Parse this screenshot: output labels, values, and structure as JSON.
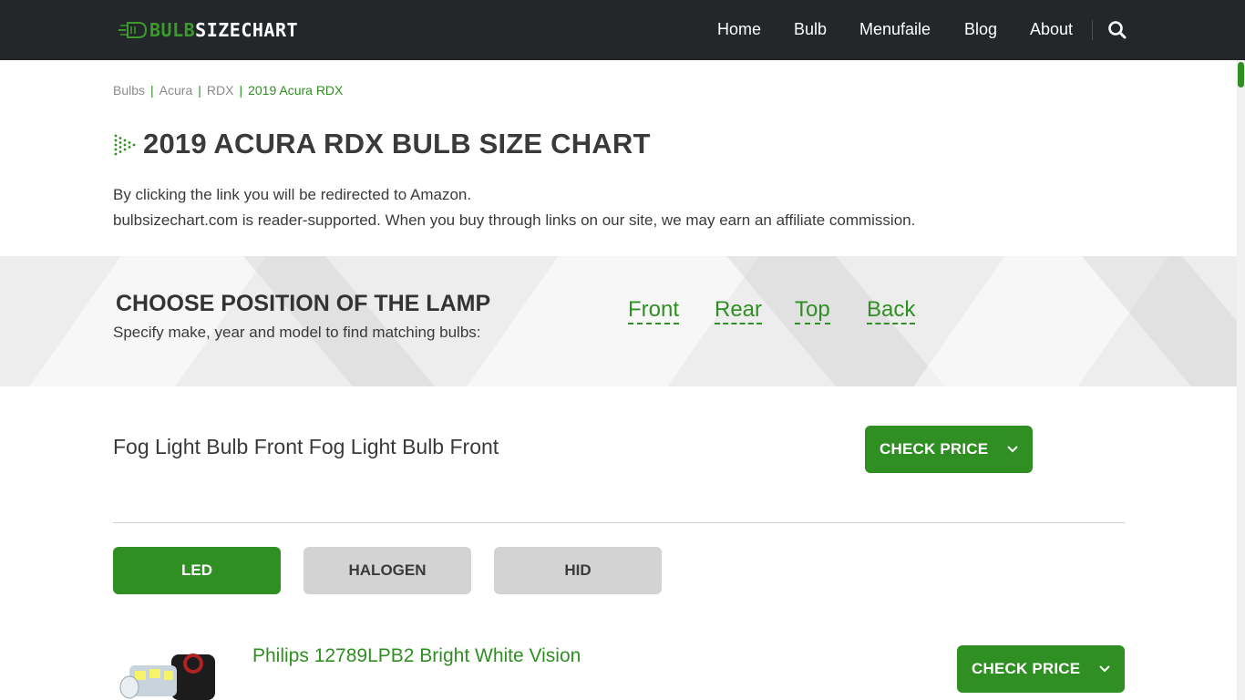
{
  "header": {
    "logo": {
      "part1": "BULB",
      "part2": "SIZECHART"
    },
    "nav": [
      {
        "label": "Home"
      },
      {
        "label": "Bulb"
      },
      {
        "label": "Menufaile"
      },
      {
        "label": "Blog"
      },
      {
        "label": "About"
      }
    ],
    "search_icon": "search-icon"
  },
  "breadcrumb": [
    {
      "label": "Bulbs"
    },
    {
      "label": "Acura"
    },
    {
      "label": "RDX"
    },
    {
      "label": "2019 Acura RDX"
    }
  ],
  "page": {
    "title": "2019 ACURA RDX BULB SIZE CHART",
    "intro_line1": "By clicking the link you will be redirected to Amazon.",
    "intro_line2": "bulbsizechart.com is reader-supported. When you buy through links on our site, we may earn an affiliate commission."
  },
  "lamp_position": {
    "heading": "CHOOSE POSITION OF THE LAMP",
    "subheading": "Specify make, year and model to find matching bulbs:",
    "options": [
      {
        "label": "Front"
      },
      {
        "label": "Rear"
      },
      {
        "label": "Top"
      },
      {
        "label": "Back"
      }
    ]
  },
  "section": {
    "title": "Fog Light Bulb Front Fog Light Bulb Front",
    "check_price_label": "CHECK PRICE"
  },
  "bulb_types": [
    {
      "label": "LED",
      "active": true
    },
    {
      "label": "HALOGEN",
      "active": false
    },
    {
      "label": "HID",
      "active": false
    }
  ],
  "product": {
    "name": "Philips 12789LPB2 Bright White Vision",
    "check_price_label": "CHECK PRICE"
  },
  "colors": {
    "accent": "#2f8f22",
    "header_bg": "#24272a",
    "tab_inactive": "#d3d3d3"
  }
}
